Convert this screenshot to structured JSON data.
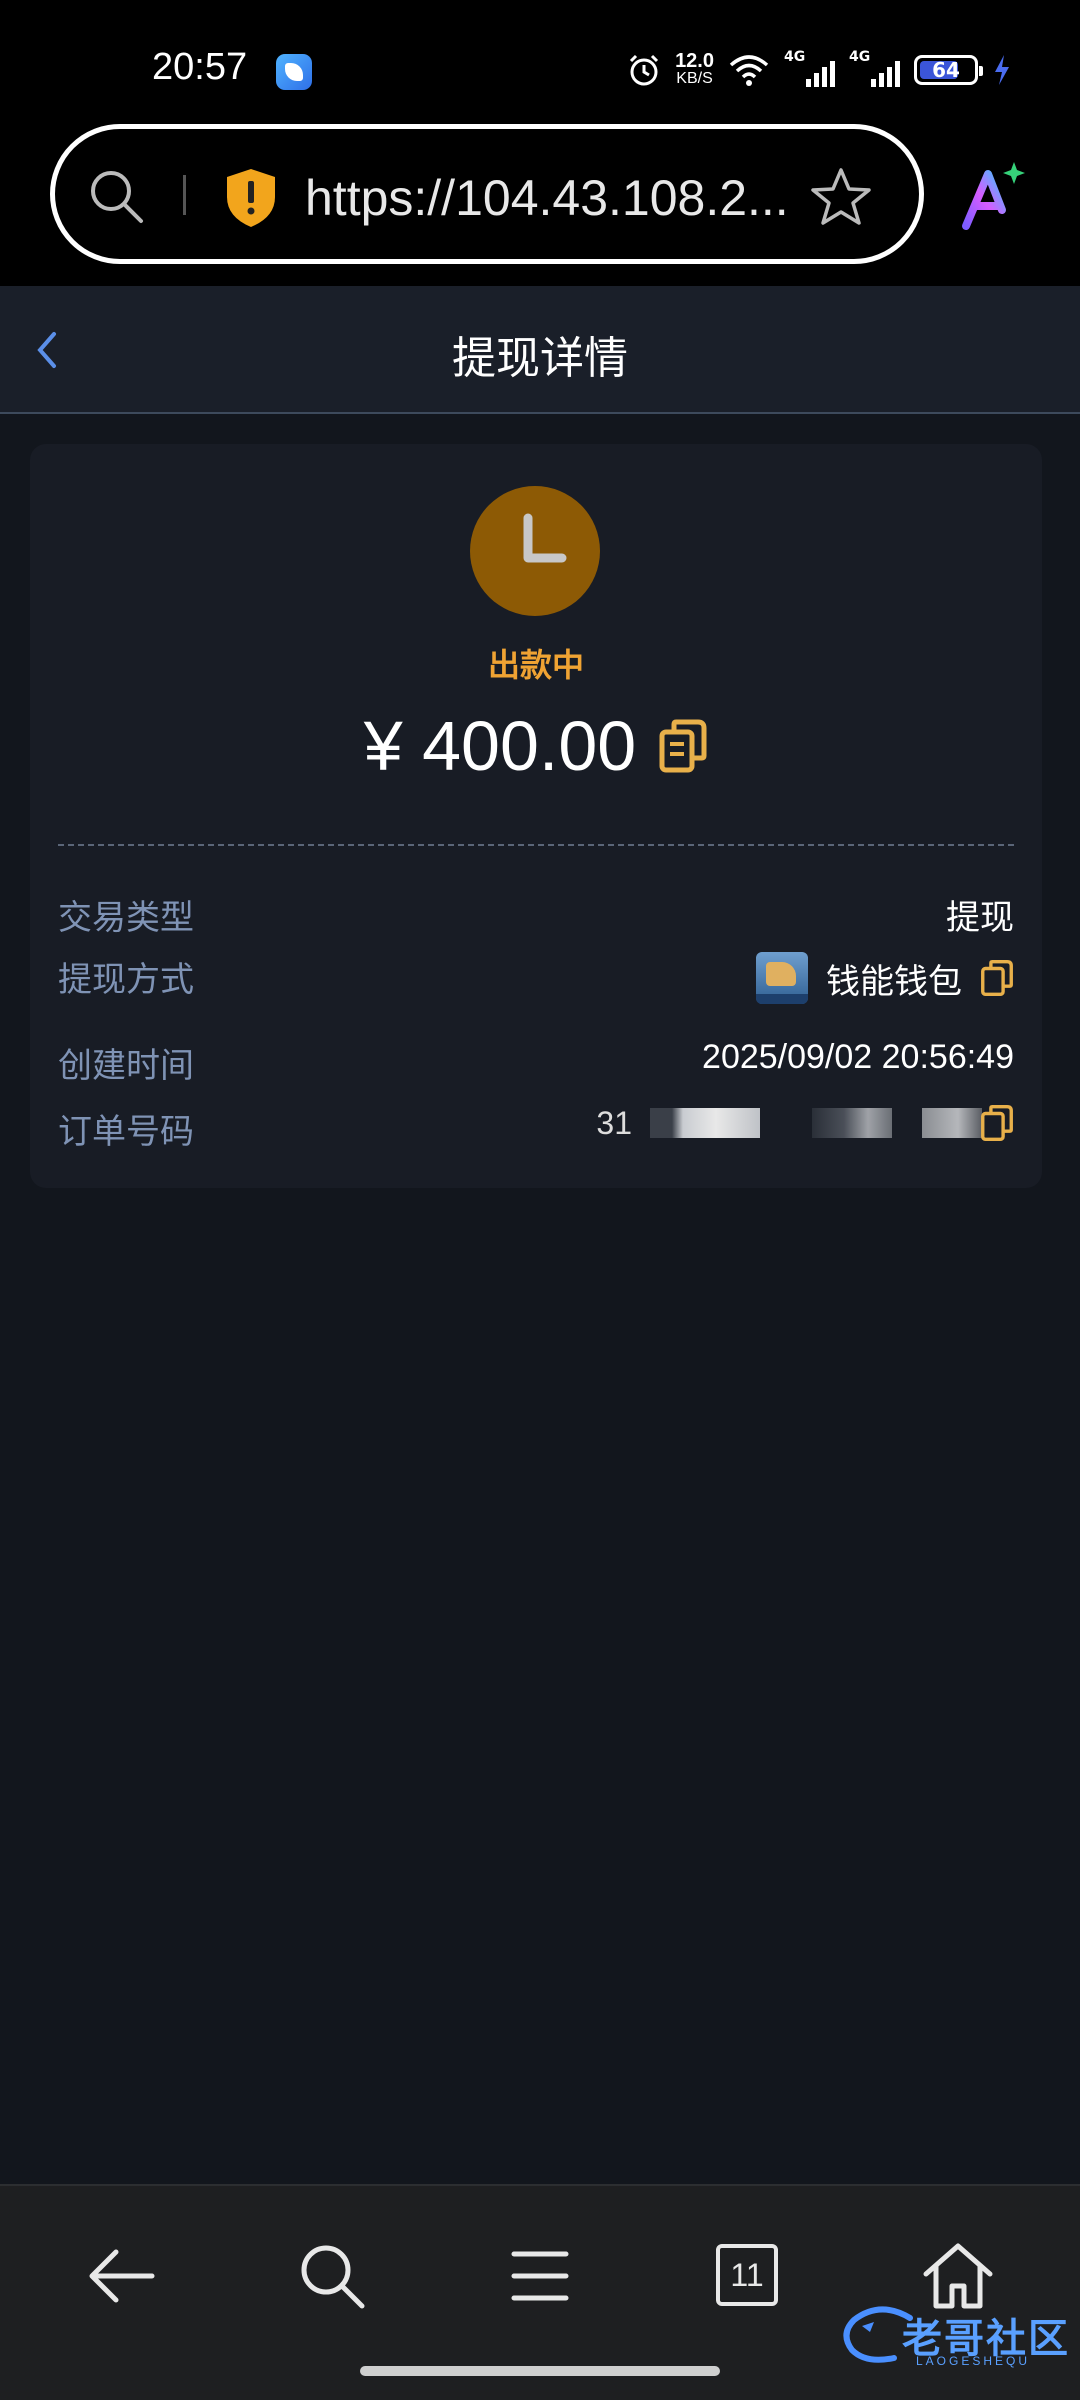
{
  "status_bar": {
    "time": "20:57",
    "net_speed_value": "12.0",
    "net_speed_unit": "KB/S",
    "signal1_tag": "4G",
    "signal2_tag": "4G",
    "battery": "64"
  },
  "browser": {
    "url": "https://104.43.108.2..."
  },
  "header": {
    "title": "提现详情"
  },
  "detail": {
    "status": "出款中",
    "amount": "¥ 400.00",
    "rows": [
      {
        "label": "交易类型",
        "value": "提现"
      },
      {
        "label": "提现方式",
        "value": "钱能钱包"
      },
      {
        "label": "创建时间",
        "value": "2025/09/02 20:56:49"
      },
      {
        "label": "订单号码",
        "value": "31"
      }
    ]
  },
  "bottom_nav": {
    "tab_count": "11"
  },
  "watermark": {
    "text": "老哥社区",
    "sub": "LAOGESHEQU"
  },
  "colors": {
    "accent": "#f0a333",
    "label": "#7f93b5",
    "background": "#12161d",
    "card": "#181c25"
  }
}
